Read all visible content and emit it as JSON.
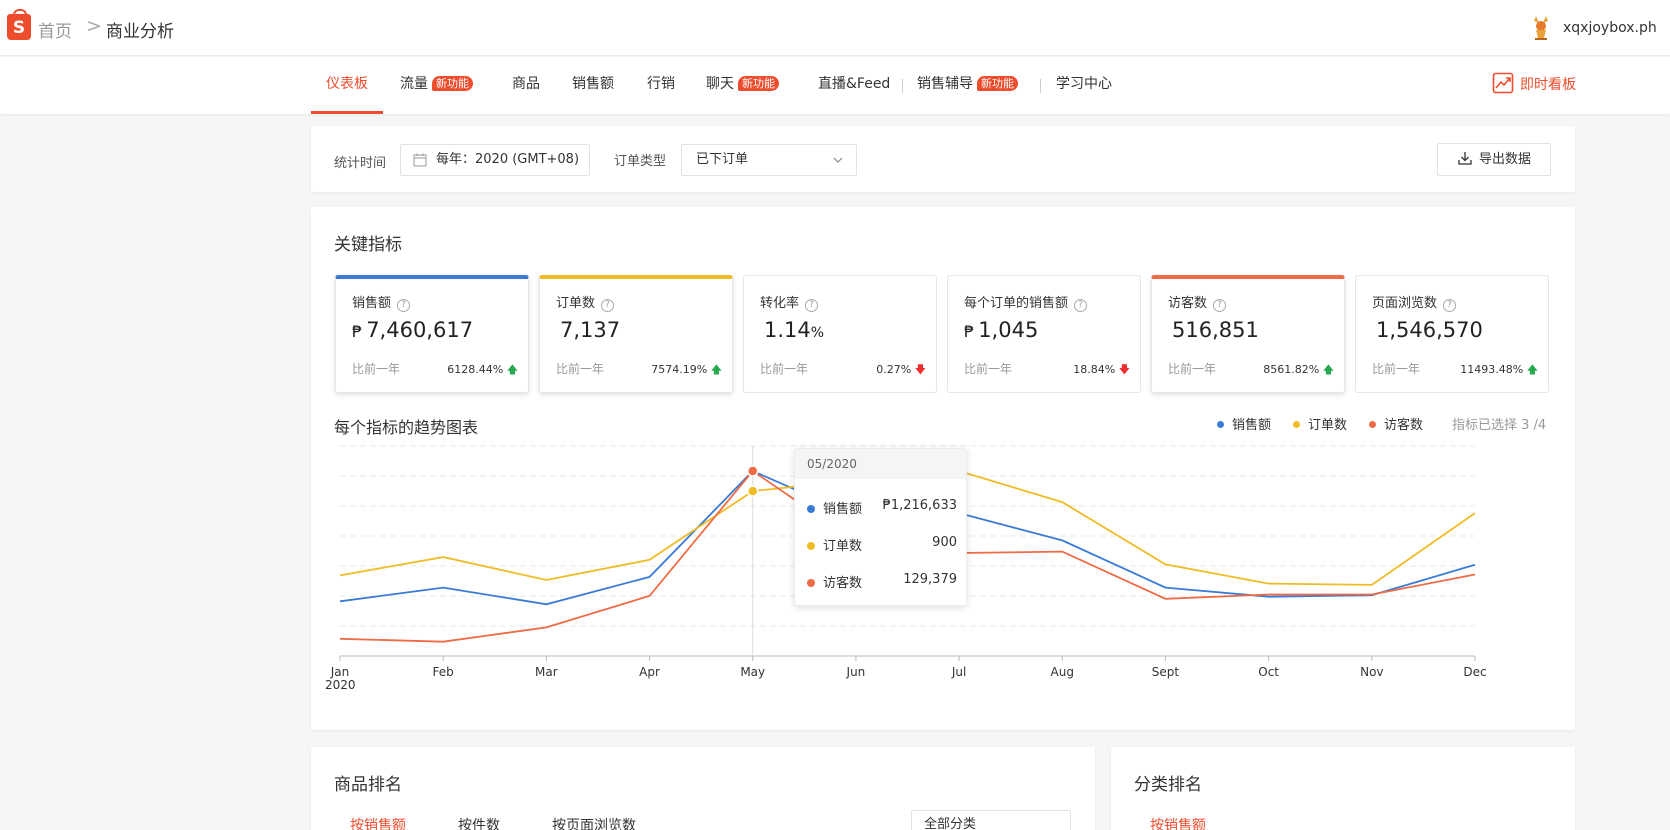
{
  "header": {
    "home": "首页",
    "separator": ">",
    "current": "商业分析",
    "shop_name": "xqxjoybox.ph"
  },
  "nav": {
    "items": [
      {
        "label": "仪表板",
        "badge": ""
      },
      {
        "label": "流量",
        "badge": "新功能"
      },
      {
        "label": "商品",
        "badge": ""
      },
      {
        "label": "销售额",
        "badge": ""
      },
      {
        "label": "行销",
        "badge": ""
      },
      {
        "label": "聊天",
        "badge": "新功能"
      },
      {
        "label": "直播&Feed",
        "badge": ""
      },
      {
        "label": "销售辅导",
        "badge": "新功能"
      },
      {
        "label": "学习中心",
        "badge": ""
      }
    ],
    "live_board": "即时看板"
  },
  "filters": {
    "time_label": "统计时间",
    "time_value": "每年：2020 (GMT+08)",
    "order_type_label": "订单类型",
    "order_type_value": "已下订单",
    "export": "导出数据"
  },
  "key_metrics": {
    "title": "关键指标",
    "compare_label": "比前一年",
    "cards": [
      {
        "label": "销售额",
        "currency": "₱",
        "value": "7,460,617",
        "unit": "",
        "change": "6128.44%",
        "direction": "up",
        "selected": true,
        "color": "#3a7bd5"
      },
      {
        "label": "订单数",
        "currency": "",
        "value": "7,137",
        "unit": "",
        "change": "7574.19%",
        "direction": "up",
        "selected": true,
        "color": "#f0bc26"
      },
      {
        "label": "转化率",
        "currency": "",
        "value": "1.14",
        "unit": "%",
        "change": "0.27%",
        "direction": "down",
        "selected": false,
        "color": ""
      },
      {
        "label": "每个订单的销售额",
        "currency": "₱",
        "value": "1,045",
        "unit": "",
        "change": "18.84%",
        "direction": "down",
        "selected": false,
        "color": ""
      },
      {
        "label": "访客数",
        "currency": "",
        "value": "516,851",
        "unit": "",
        "change": "8561.82%",
        "direction": "up",
        "selected": true,
        "color": "#ee6b45"
      },
      {
        "label": "页面浏览数",
        "currency": "",
        "value": "1,546,570",
        "unit": "",
        "change": "11493.48%",
        "direction": "up",
        "selected": false,
        "color": ""
      }
    ]
  },
  "trend": {
    "title": "每个指标的趋势图表",
    "legend": [
      {
        "name": "销售额",
        "color": "#3a7bd5"
      },
      {
        "name": "订单数",
        "color": "#f0bc26"
      },
      {
        "name": "访客数",
        "color": "#ee6b45"
      }
    ],
    "selected_count": "指标已选择 3 /4",
    "tooltip": {
      "date": "05/2020",
      "rows": [
        {
          "name": "销售额",
          "value": "₱1,216,633",
          "color": "#3a7bd5"
        },
        {
          "name": "订单数",
          "value": "900",
          "color": "#f0bc26"
        },
        {
          "name": "访客数",
          "value": "129,379",
          "color": "#ee6b45"
        }
      ]
    }
  },
  "chart_data": {
    "type": "line",
    "x": [
      "Jan",
      "Feb",
      "Mar",
      "Apr",
      "May",
      "Jun",
      "Jul",
      "Aug",
      "Sept",
      "Oct",
      "Nov",
      "Dec"
    ],
    "year_label": "2020",
    "series": [
      {
        "name": "销售额",
        "color": "#3a7bd5",
        "values": [
          360000,
          450000,
          340000,
          520000,
          1216633,
          920000,
          940000,
          760000,
          450000,
          390000,
          400000,
          600000
        ]
      },
      {
        "name": "订单数",
        "color": "#f0bc26",
        "values": [
          440,
          540,
          415,
          525,
          900,
          960,
          1010,
          840,
          500,
          395,
          388,
          780
        ]
      },
      {
        "name": "访客数",
        "color": "#ee6b45",
        "values": [
          12000,
          10000,
          20000,
          42000,
          129379,
          80000,
          72000,
          73000,
          40000,
          43000,
          43000,
          57000
        ]
      }
    ],
    "grid": true,
    "legend_position": "top-right"
  },
  "ranking": {
    "product_title": "商品排名",
    "category_title": "分类排名",
    "tabs": [
      "按销售额",
      "按件数",
      "按页面浏览数"
    ],
    "category_tab": "按销售额",
    "category_select": "全部分类"
  }
}
